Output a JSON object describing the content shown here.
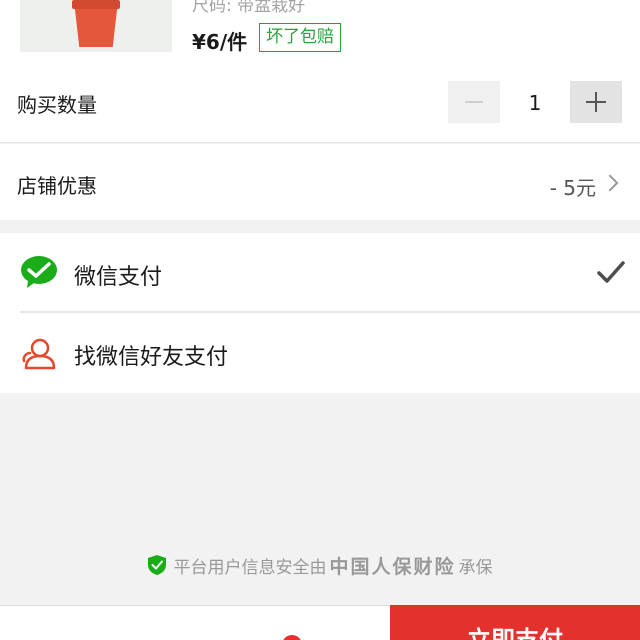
{
  "product": {
    "spec": "尺码: 带盆栽好",
    "price": "¥6/件",
    "guarantee": "坏了包赔"
  },
  "quantity": {
    "label": "购买数量",
    "value": "1"
  },
  "discount": {
    "label": "店铺优惠",
    "value": "- 5元"
  },
  "payment": {
    "options": [
      {
        "label": "微信支付",
        "icon": "wechat-icon",
        "selected": true
      },
      {
        "label": "找微信好友支付",
        "icon": "friend-icon",
        "selected": false
      }
    ]
  },
  "insurance": {
    "prefix": "平台用户信息安全由",
    "brand": "中国人保财险",
    "suffix": "承保"
  },
  "bottom": {
    "pay_button": "立即支付"
  },
  "colors": {
    "accent_red": "#e3312d",
    "wechat_green": "#1aad19",
    "badge_green": "#24a33a"
  }
}
